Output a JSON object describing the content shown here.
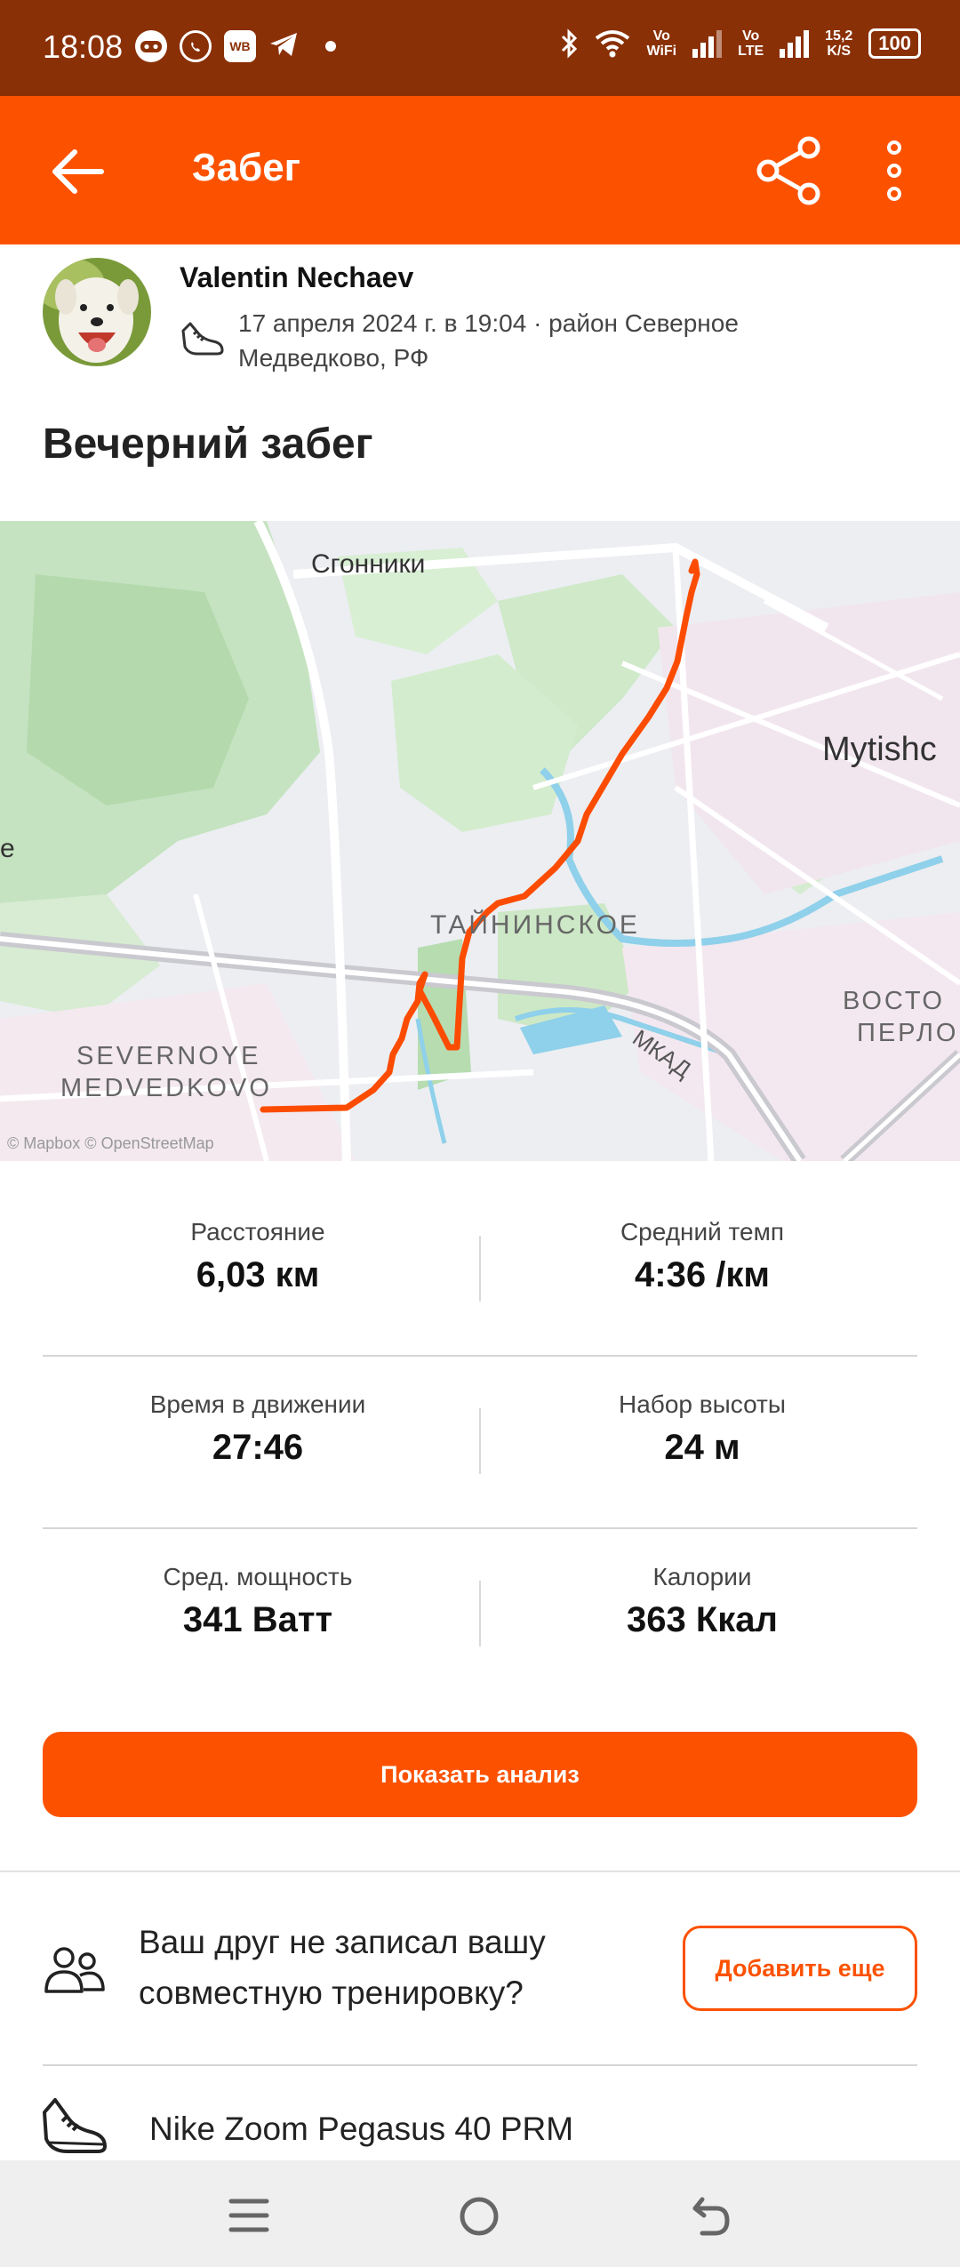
{
  "status_bar": {
    "time": "18:08",
    "apps": [
      "robot-app-icon",
      "whatsapp-icon",
      "wb-app-icon",
      "telegram-icon"
    ],
    "wb_label": "WB",
    "vowifi_top": "Vo",
    "vowifi_bottom": "WiFi",
    "volte_top": "Vo",
    "volte_bottom": "LTE",
    "speed_top": "15,2",
    "speed_bottom": "K/S",
    "battery": "100"
  },
  "toolbar": {
    "title": "Забег"
  },
  "activity": {
    "athlete": "Valentin Nechaev",
    "meta": "17 апреля 2024 г. в 19:04 · район Северное Медведково, РФ",
    "title": "Вечерний забег"
  },
  "map": {
    "labels": {
      "sgonniki": "Сгонники",
      "mytishchi": "Mytishc",
      "tayninskoe": "ТАЙНИНСКОЕ",
      "severnoye": "SEVERNOYE",
      "medvedkovo": "MEDVEDKOVO",
      "mkad": "МКАД",
      "vosto": "ВОСТО",
      "perlo": "ПЕРЛО",
      "edge_e": "e"
    },
    "copyright": "© Mapbox © OpenStreetMap",
    "route_color": "#fc4c02"
  },
  "stats": [
    {
      "label": "Расстояние",
      "value": "6,03 км"
    },
    {
      "label": "Средний темп",
      "value": "4:36 /км"
    },
    {
      "label": "Время в движении",
      "value": "27:46"
    },
    {
      "label": "Набор высоты",
      "value": "24 м"
    },
    {
      "label": "Сред. мощность",
      "value": "341 Ватт"
    },
    {
      "label": "Калории",
      "value": "363 Ккал"
    }
  ],
  "analysis_button": "Показать анализ",
  "friend_prompt": {
    "text": "Ваш друг не записал вашу совместную тренировку?",
    "button": "Добавить еще"
  },
  "gear": {
    "name": "Nike Zoom Pegasus 40 PRM"
  },
  "colors": {
    "brand": "#fc5200",
    "status_bar": "#8a3006"
  }
}
